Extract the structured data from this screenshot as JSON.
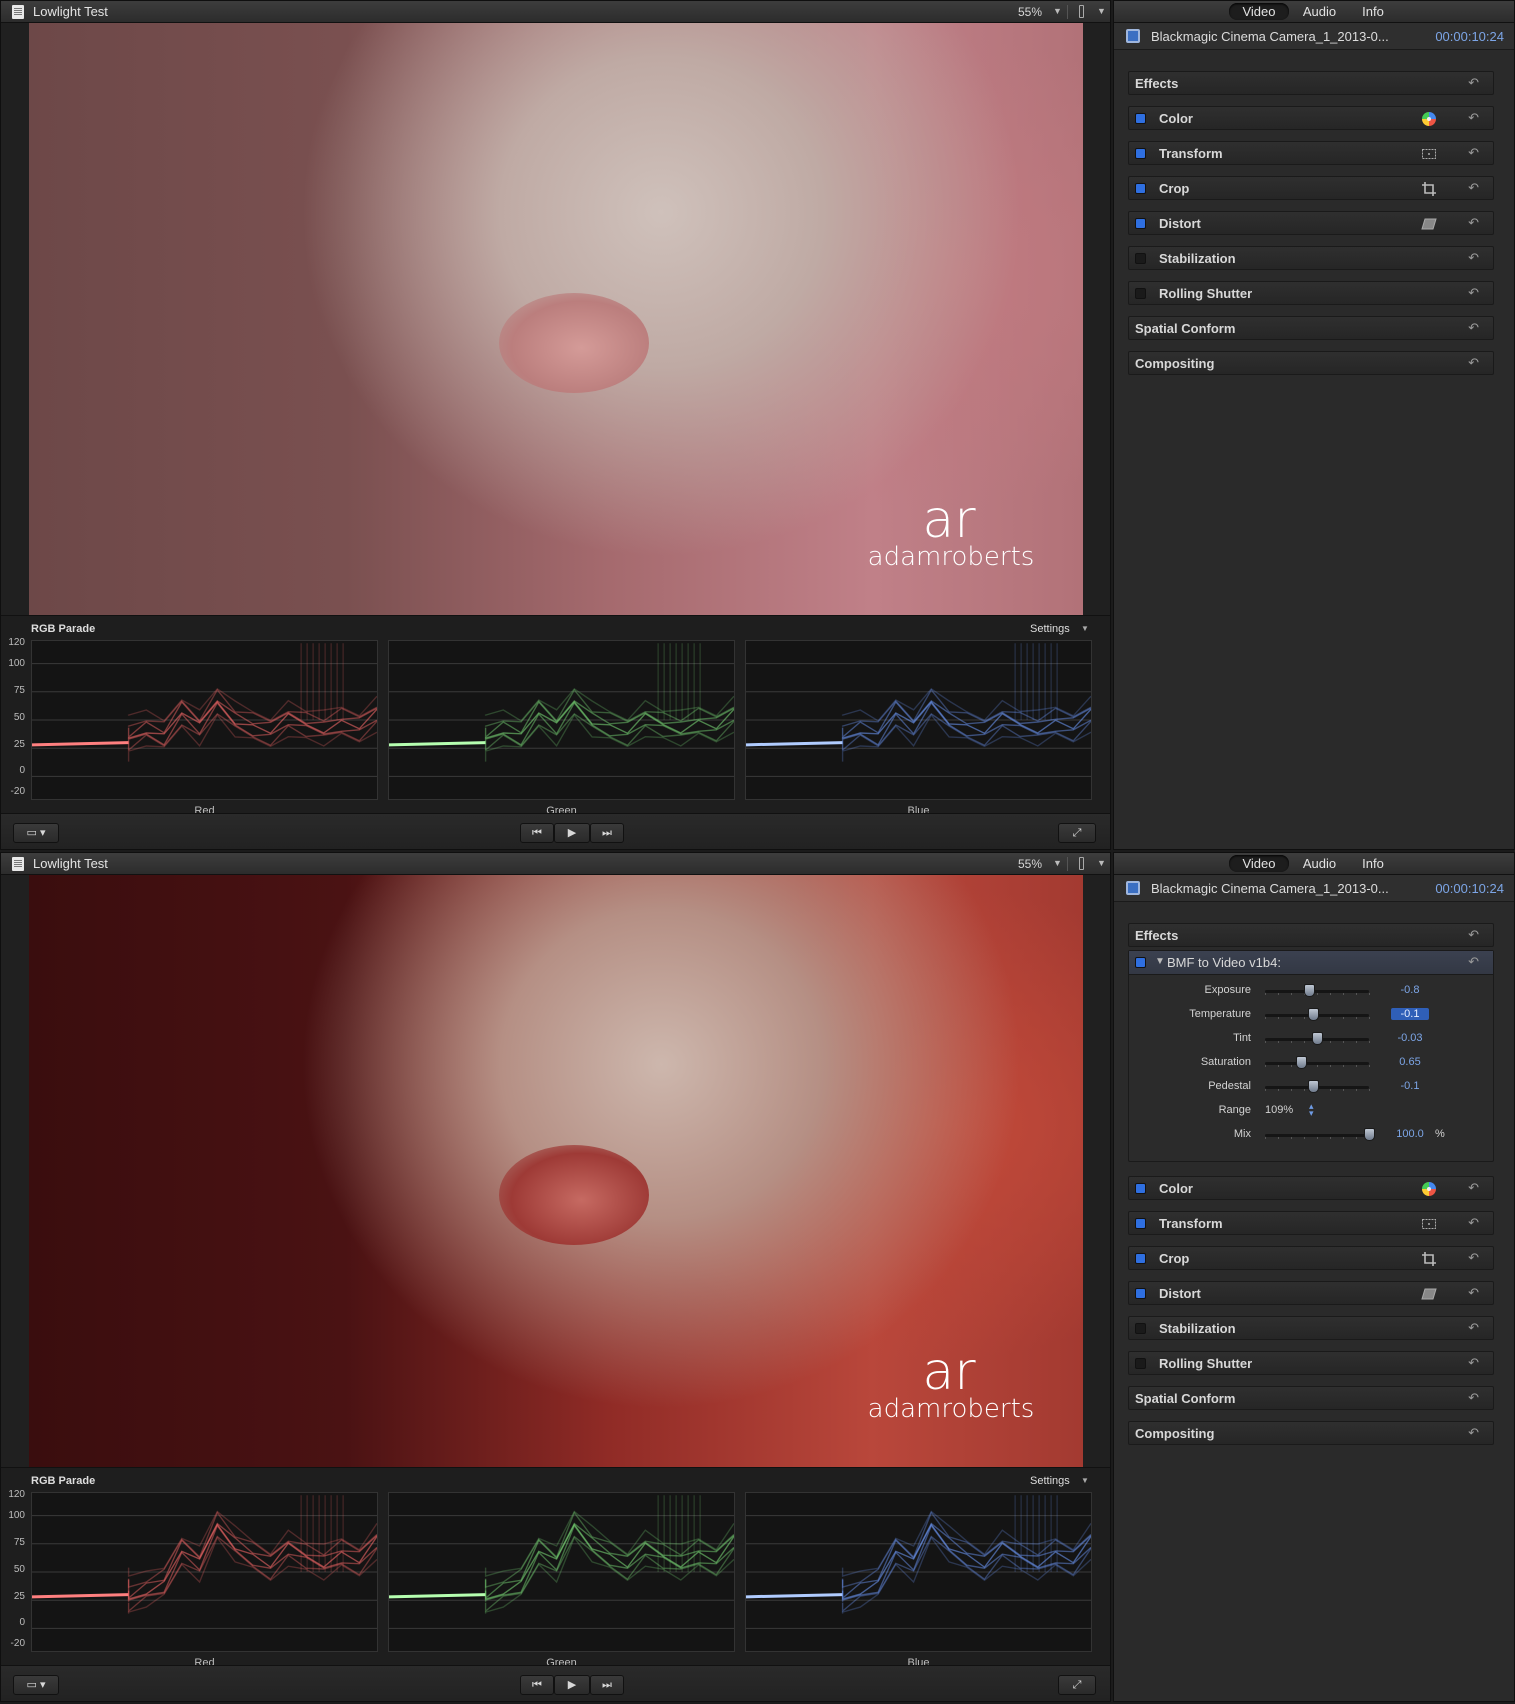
{
  "panes": [
    {
      "id": "top",
      "viewer": {
        "title": "Lowlight Test",
        "zoom": "55%",
        "scope": {
          "title": "RGB Parade",
          "settings": "Settings",
          "scale": [
            "120",
            "100",
            "75",
            "50",
            "25",
            "0",
            "-20"
          ],
          "channels": [
            {
              "label": "Red",
              "color": "#ff6b6b",
              "base": "#ff8080"
            },
            {
              "label": "Green",
              "color": "#7de07a",
              "base": "#b6ffb0"
            },
            {
              "label": "Blue",
              "color": "#6f9cff",
              "base": "#b0ccff"
            }
          ],
          "levels": [
            34,
            42,
            36,
            58,
            44,
            66,
            50,
            44,
            40,
            52,
            46,
            42,
            48,
            44,
            56
          ]
        }
      },
      "inspector": {
        "tabs": [
          "Video",
          "Audio",
          "Info"
        ],
        "clip_name": "Blackmagic Cinema Camera_1_2013-0...",
        "timecode": "00:00:10:24",
        "effects_label": "Effects",
        "bmf": null,
        "rows": [
          {
            "label": "Color",
            "check": "on",
            "icon": "color-wheel-icon"
          },
          {
            "label": "Transform",
            "check": "on",
            "icon": "transform-icon"
          },
          {
            "label": "Crop",
            "check": "on",
            "icon": "crop-icon"
          },
          {
            "label": "Distort",
            "check": "on",
            "icon": "distort-icon"
          },
          {
            "label": "Stabilization",
            "check": "off",
            "icon": ""
          },
          {
            "label": "Rolling Shutter",
            "check": "off",
            "icon": ""
          },
          {
            "label": "Spatial Conform",
            "check": "none",
            "icon": ""
          },
          {
            "label": "Compositing",
            "check": "none",
            "icon": ""
          }
        ]
      }
    },
    {
      "id": "bottom",
      "viewer": {
        "title": "Lowlight Test",
        "zoom": "55%",
        "scope": {
          "title": "RGB Parade",
          "settings": "Settings",
          "scale": [
            "120",
            "100",
            "75",
            "50",
            "25",
            "0",
            "-20"
          ],
          "channels": [
            {
              "label": "Red",
              "color": "#ff6b6b",
              "base": "#ff8080"
            },
            {
              "label": "Green",
              "color": "#7de07a",
              "base": "#b6ffb0"
            },
            {
              "label": "Blue",
              "color": "#6f9cff",
              "base": "#b0ccff"
            }
          ],
          "levels": [
            26,
            34,
            40,
            70,
            58,
            92,
            74,
            64,
            56,
            72,
            64,
            58,
            66,
            60,
            78
          ]
        }
      },
      "inspector": {
        "tabs": [
          "Video",
          "Audio",
          "Info"
        ],
        "clip_name": "Blackmagic Cinema Camera_1_2013-0...",
        "timecode": "00:00:10:24",
        "effects_label": "Effects",
        "bmf": {
          "title": "BMF to Video v1b4:",
          "params": [
            {
              "label": "Exposure",
              "value": "-0.8",
              "fraction": 0.42,
              "selected": false
            },
            {
              "label": "Temperature",
              "value": "-0.1",
              "fraction": 0.46,
              "selected": true
            },
            {
              "label": "Tint",
              "value": "-0.03",
              "fraction": 0.5,
              "selected": false
            },
            {
              "label": "Saturation",
              "value": "0.65",
              "fraction": 0.35,
              "selected": false
            },
            {
              "label": "Pedestal",
              "value": "-0.1",
              "fraction": 0.46,
              "selected": false
            },
            {
              "label": "Range",
              "value": "109%",
              "type": "popup"
            },
            {
              "label": "Mix",
              "value": "100.0",
              "unit": "%",
              "fraction": 1.0,
              "selected": false
            }
          ]
        },
        "rows": [
          {
            "label": "Color",
            "check": "on",
            "icon": "color-wheel-icon"
          },
          {
            "label": "Transform",
            "check": "on",
            "icon": "transform-icon"
          },
          {
            "label": "Crop",
            "check": "on",
            "icon": "crop-icon"
          },
          {
            "label": "Distort",
            "check": "on",
            "icon": "distort-icon"
          },
          {
            "label": "Stabilization",
            "check": "off",
            "icon": ""
          },
          {
            "label": "Rolling Shutter",
            "check": "off",
            "icon": ""
          },
          {
            "label": "Spatial Conform",
            "check": "none",
            "icon": ""
          },
          {
            "label": "Compositing",
            "check": "none",
            "icon": ""
          }
        ]
      }
    }
  ],
  "watermark": {
    "logo": "ar",
    "text": "adamroberts"
  }
}
